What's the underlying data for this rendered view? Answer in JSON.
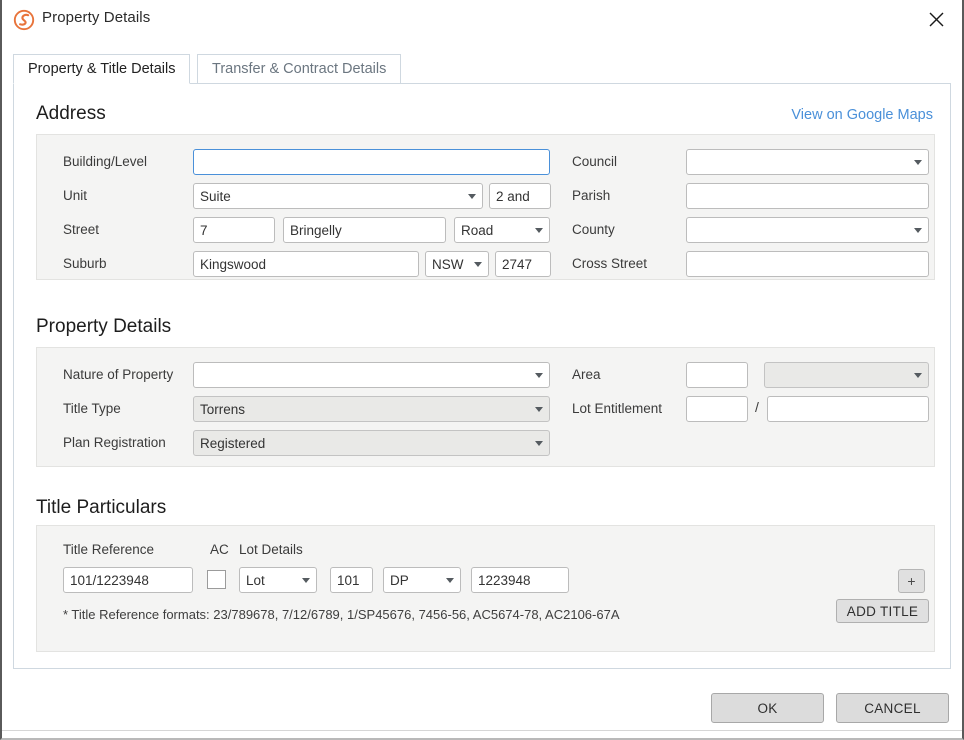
{
  "window": {
    "title": "Property Details",
    "app_icon": "swirl-logo-icon",
    "close_icon": "close-icon"
  },
  "tabs": [
    {
      "label": "Property & Title Details",
      "active": true
    },
    {
      "label": "Transfer & Contract Details",
      "active": false
    }
  ],
  "address": {
    "heading": "Address",
    "maps_link": "View on Google Maps",
    "labels": {
      "building_level": "Building/Level",
      "unit": "Unit",
      "street": "Street",
      "suburb": "Suburb",
      "council": "Council",
      "parish": "Parish",
      "county": "County",
      "cross_street": "Cross Street"
    },
    "values": {
      "building_level": "",
      "unit_type": "Suite",
      "unit_number": "2 and",
      "street_number": "7",
      "street_name": "Bringelly",
      "street_type": "Road",
      "suburb": "Kingswood",
      "state": "NSW",
      "postcode": "2747",
      "council": "",
      "parish": "",
      "county": "",
      "cross_street": ""
    }
  },
  "property_details": {
    "heading": "Property Details",
    "labels": {
      "nature_of_property": "Nature of Property",
      "title_type": "Title Type",
      "plan_registration": "Plan Registration",
      "area": "Area",
      "lot_entitlement": "Lot Entitlement",
      "separator": "/"
    },
    "values": {
      "nature_of_property": "",
      "title_type": "Torrens",
      "plan_registration": "Registered",
      "area_value": "",
      "area_unit": "",
      "lot_entitlement_numerator": "",
      "lot_entitlement_denominator": ""
    }
  },
  "title_particulars": {
    "heading": "Title Particulars",
    "columns": {
      "title_reference": "Title Reference",
      "ac": "AC",
      "lot_details": "Lot Details"
    },
    "row": {
      "title_reference": "101/1223948",
      "ac_checked": false,
      "lot_label": "Lot",
      "lot_number": "101",
      "plan_type": "DP",
      "plan_number": "1223948"
    },
    "add_row_button": "+",
    "hint": "* Title Reference formats: 23/789678, 7/12/6789, 1/SP45676, 7456-56, AC5674-78, AC2106-67A",
    "add_title_button": "ADD TITLE"
  },
  "footer": {
    "ok": "OK",
    "cancel": "CANCEL"
  },
  "colors": {
    "accent_orange": "#e8743b",
    "link_blue": "#4a90d9",
    "focus_blue": "#4a90d9",
    "panel_bg": "#f4f4f3",
    "button_bg": "#dcdcdc"
  }
}
